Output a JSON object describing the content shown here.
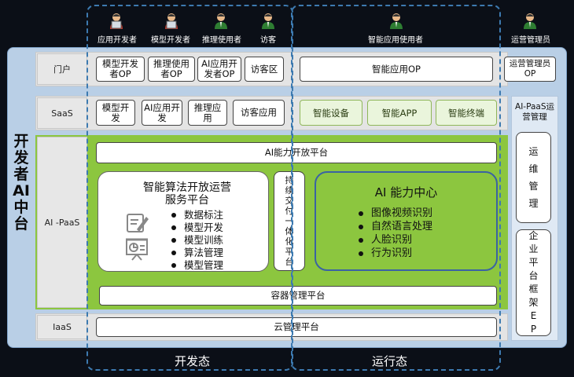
{
  "roles": {
    "app_dev": "应用开发者",
    "model_dev": "模型开发者",
    "infer_user": "推理使用者",
    "visitor": "访客",
    "smart_app_user": "智能应用使用者",
    "ops_admin": "运营管理员"
  },
  "side_title": "开发者AI中台",
  "rows": {
    "portal": "门户",
    "saas": "SaaS",
    "paas": "AI -PaaS",
    "iaas": "IaaS"
  },
  "portal": {
    "items": [
      "模型开发者OP",
      "推理使用者OP",
      "AI应用开发者OP",
      "访客区"
    ],
    "smart_app_op": "智能应用OP",
    "ops_admin_op": "运营管理员OP"
  },
  "saas": {
    "items": [
      "模型开发",
      "AI应用开发",
      "推理应用",
      "访客应用"
    ],
    "smart_items": [
      "智能设备",
      "智能APP",
      "智能终端"
    ],
    "ops_title": "AI-PaaS运营管理"
  },
  "paas": {
    "open_platform": "AI能力开放平台",
    "algo_title_1": "智能算法开放运营",
    "algo_title_2": "服务平台",
    "algo_items": [
      "数据标注",
      "模型开发",
      "模型训练",
      "算法管理",
      "模型管理"
    ],
    "cicd": "持续交付一体化平台",
    "ai_center_title": "AI 能力中心",
    "ai_center_items": [
      "图像视频识别",
      "自然语言处理",
      "人脸识别",
      "行为识别"
    ],
    "container": "容器管理平台",
    "ops_mgmt": "运维管理",
    "enterprise": "企业平台框架EP"
  },
  "iaas": {
    "cloud": "云管理平台"
  },
  "states": {
    "dev": "开发态",
    "run": "运行态"
  }
}
